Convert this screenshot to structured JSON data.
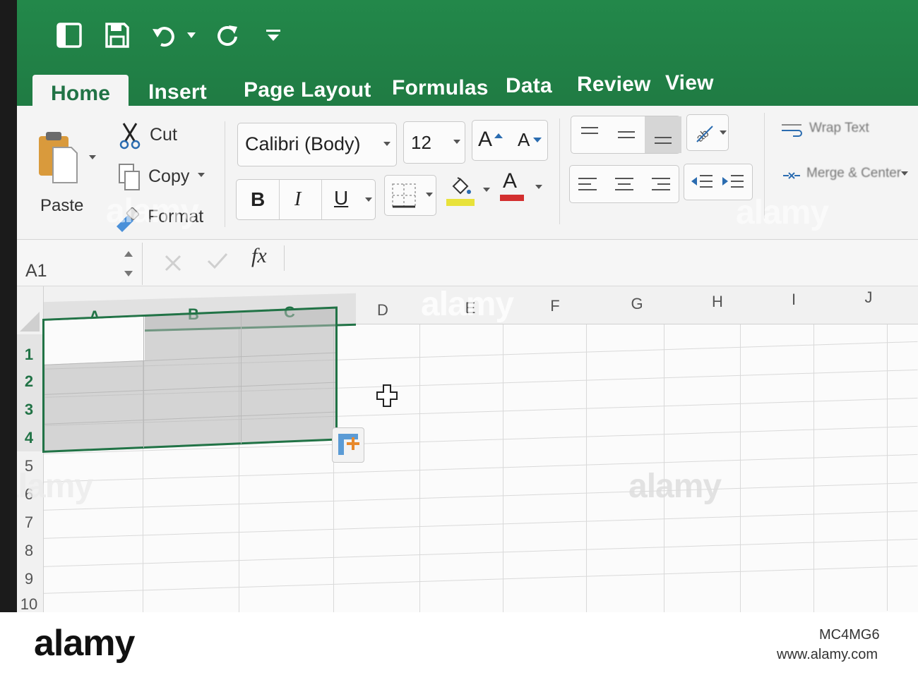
{
  "tabs": [
    "Home",
    "Insert",
    "Page Layout",
    "Formulas",
    "Data",
    "Review",
    "View"
  ],
  "clipboard": {
    "paste_label": "Paste",
    "cut_label": "Cut",
    "copy_label": "Copy",
    "format_label": "Format"
  },
  "font": {
    "name": "Calibri (Body)",
    "size": "12",
    "bold": "B",
    "italic": "I",
    "underline": "U",
    "grow_glyph": "A",
    "shrink_glyph": "A",
    "font_color_glyph": "A",
    "highlight_color": "#e8e23a",
    "font_color": "#d32f2f"
  },
  "alignment": {
    "wrap_text_label": "Wrap Text",
    "merge_center_label": "Merge & Center"
  },
  "formula_bar": {
    "name_box": "A1",
    "fx_label": "fx",
    "formula": ""
  },
  "columns": [
    "A",
    "B",
    "C",
    "D",
    "E",
    "F",
    "G",
    "H",
    "I",
    "J"
  ],
  "rows": [
    "1",
    "2",
    "3",
    "4",
    "5",
    "6",
    "7",
    "8",
    "9",
    "10"
  ],
  "selection": {
    "columns": [
      "A",
      "B",
      "C"
    ],
    "rows": [
      "1",
      "2",
      "3",
      "4"
    ]
  },
  "colors": {
    "accent": "#217346",
    "titlebar": "#1f7a43"
  },
  "watermark": {
    "logo": "alamy",
    "image_id": "MC4MG6",
    "url": "www.alamy.com",
    "overlay_text": "alamy"
  }
}
